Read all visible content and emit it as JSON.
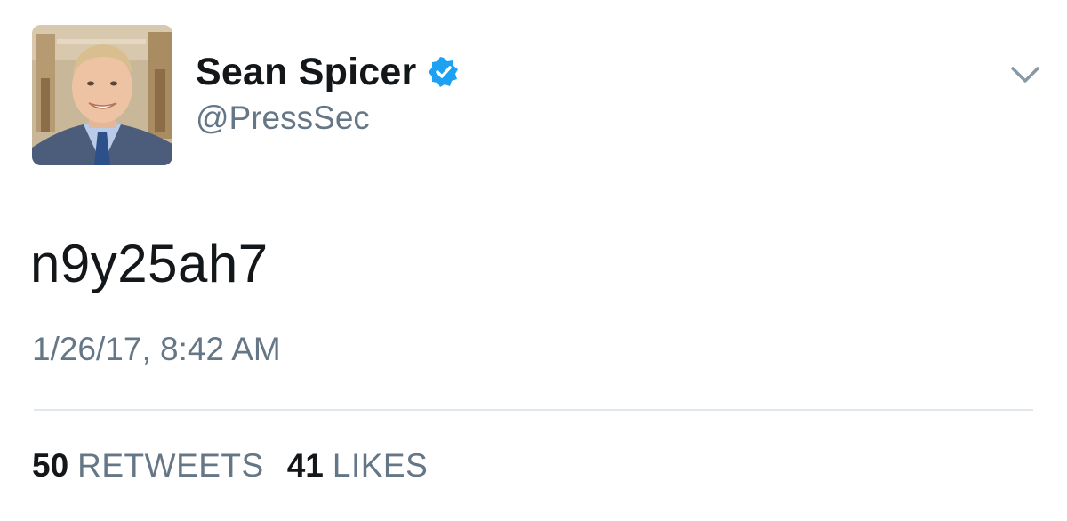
{
  "author": {
    "display_name": "Sean Spicer",
    "handle": "@PressSec",
    "verified": true,
    "avatar_icon": "profile-photo"
  },
  "tweet": {
    "text": "n9y25ah7",
    "timestamp": "1/26/17, 8:42 AM"
  },
  "stats": {
    "retweets_count": "50",
    "retweets_label": "RETWEETS",
    "likes_count": "41",
    "likes_label": "LIKES"
  },
  "icons": {
    "verified": "verified-badge-icon",
    "menu": "chevron-down-icon"
  },
  "colors": {
    "primary_text": "#14171a",
    "secondary_text": "#657786",
    "verified_blue": "#1da1f2",
    "divider": "#e1e8ed"
  }
}
